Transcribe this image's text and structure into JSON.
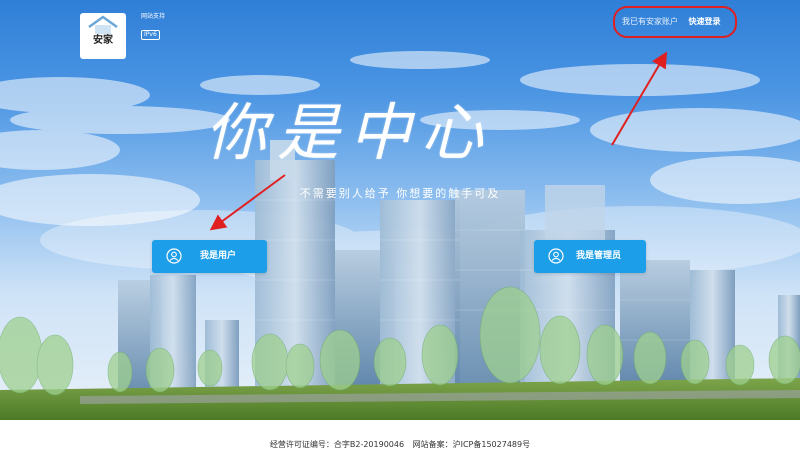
{
  "brand": {
    "name": "安家",
    "tagline": "",
    "ipv6_label": "网站支持",
    "ipv6_badge": "IPv6"
  },
  "login": {
    "question": "我已有安家账户",
    "link": "快速登录"
  },
  "hero": {
    "headline": "你是中心",
    "slogan": "不需要别人给予  你想要的触手可及"
  },
  "buttons": {
    "user": "我是用户",
    "admin": "我是管理员"
  },
  "footer": {
    "license": "经营许可证编号：合字B2-20190046",
    "record": "网站备案：沪ICP备15027489号"
  },
  "colors": {
    "button_bg": "#1d9ee8",
    "annotation": "#e02020",
    "sky_top": "#2f7fd8"
  }
}
